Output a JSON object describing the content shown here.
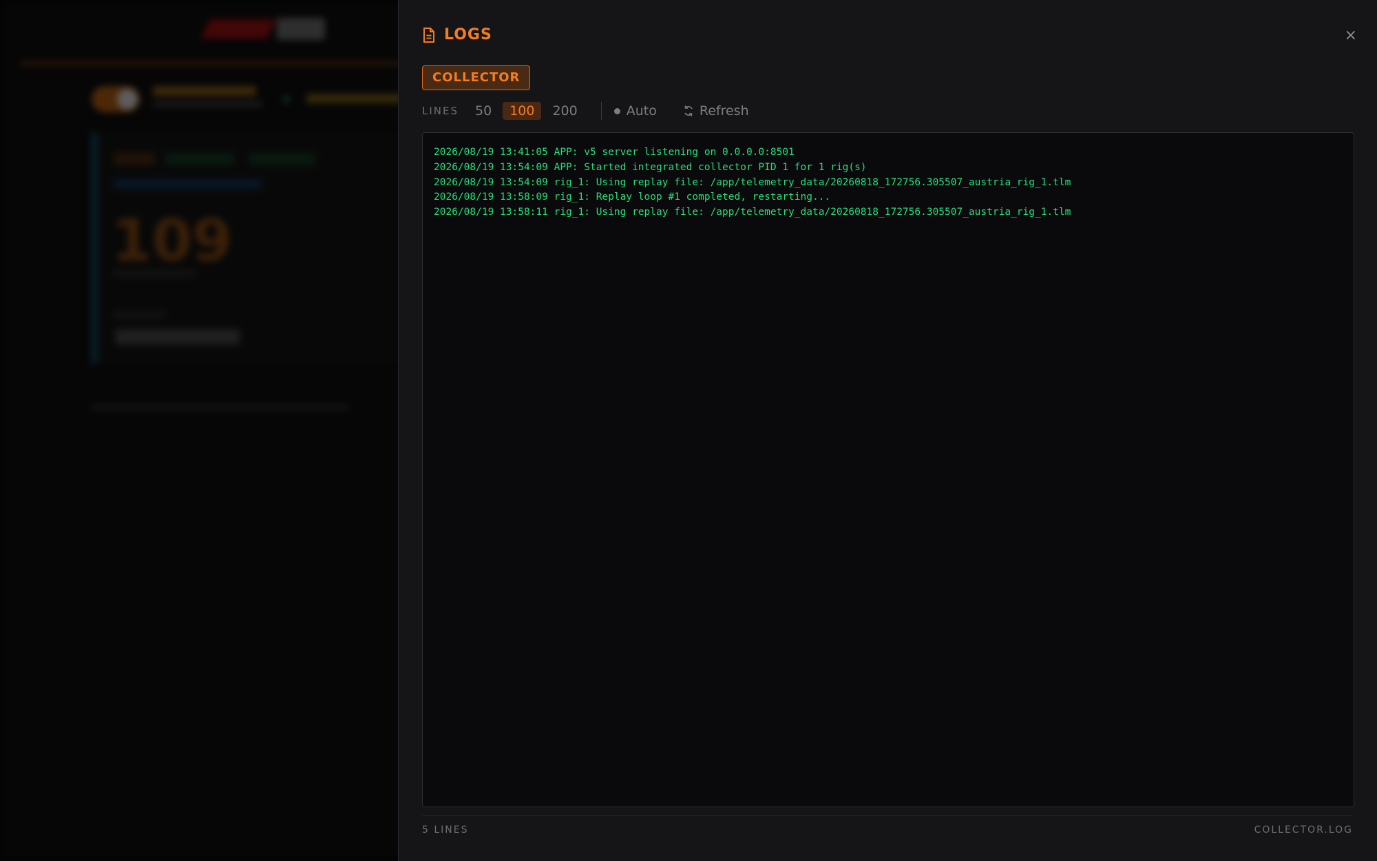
{
  "panel": {
    "title": "LOGS",
    "close_label": "×",
    "source_tab": "COLLECTOR",
    "lines_label": "LINES",
    "line_counts": [
      "50",
      "100",
      "200"
    ],
    "selected_line_count": "100",
    "auto_label": "Auto",
    "refresh_label": "Refresh",
    "log_lines": [
      "2026/08/19 13:41:05 APP: v5 server listening on 0.0.0.0:8501",
      "2026/08/19 13:54:09 APP: Started integrated collector PID 1 for 1 rig(s)",
      "2026/08/19 13:54:09 rig_1: Using replay file: /app/telemetry_data/20260818_172756.305507_austria_rig_1.tlm",
      "2026/08/19 13:58:09 rig_1: Replay loop #1 completed, restarting...",
      "2026/08/19 13:58:11 rig_1: Using replay file: /app/telemetry_data/20260818_172756.305507_austria_rig_1.tlm"
    ],
    "footer_count": "5 LINES",
    "footer_file": "COLLECTOR.LOG"
  },
  "background": {
    "big_number": "109"
  },
  "colors": {
    "accent": "#f57d1f",
    "log_text": "#22e07a",
    "drawer_bg": "#151517"
  },
  "icons": {
    "title_icon": "document-icon",
    "refresh_icon": "refresh-icon",
    "close_icon": "close-icon"
  }
}
